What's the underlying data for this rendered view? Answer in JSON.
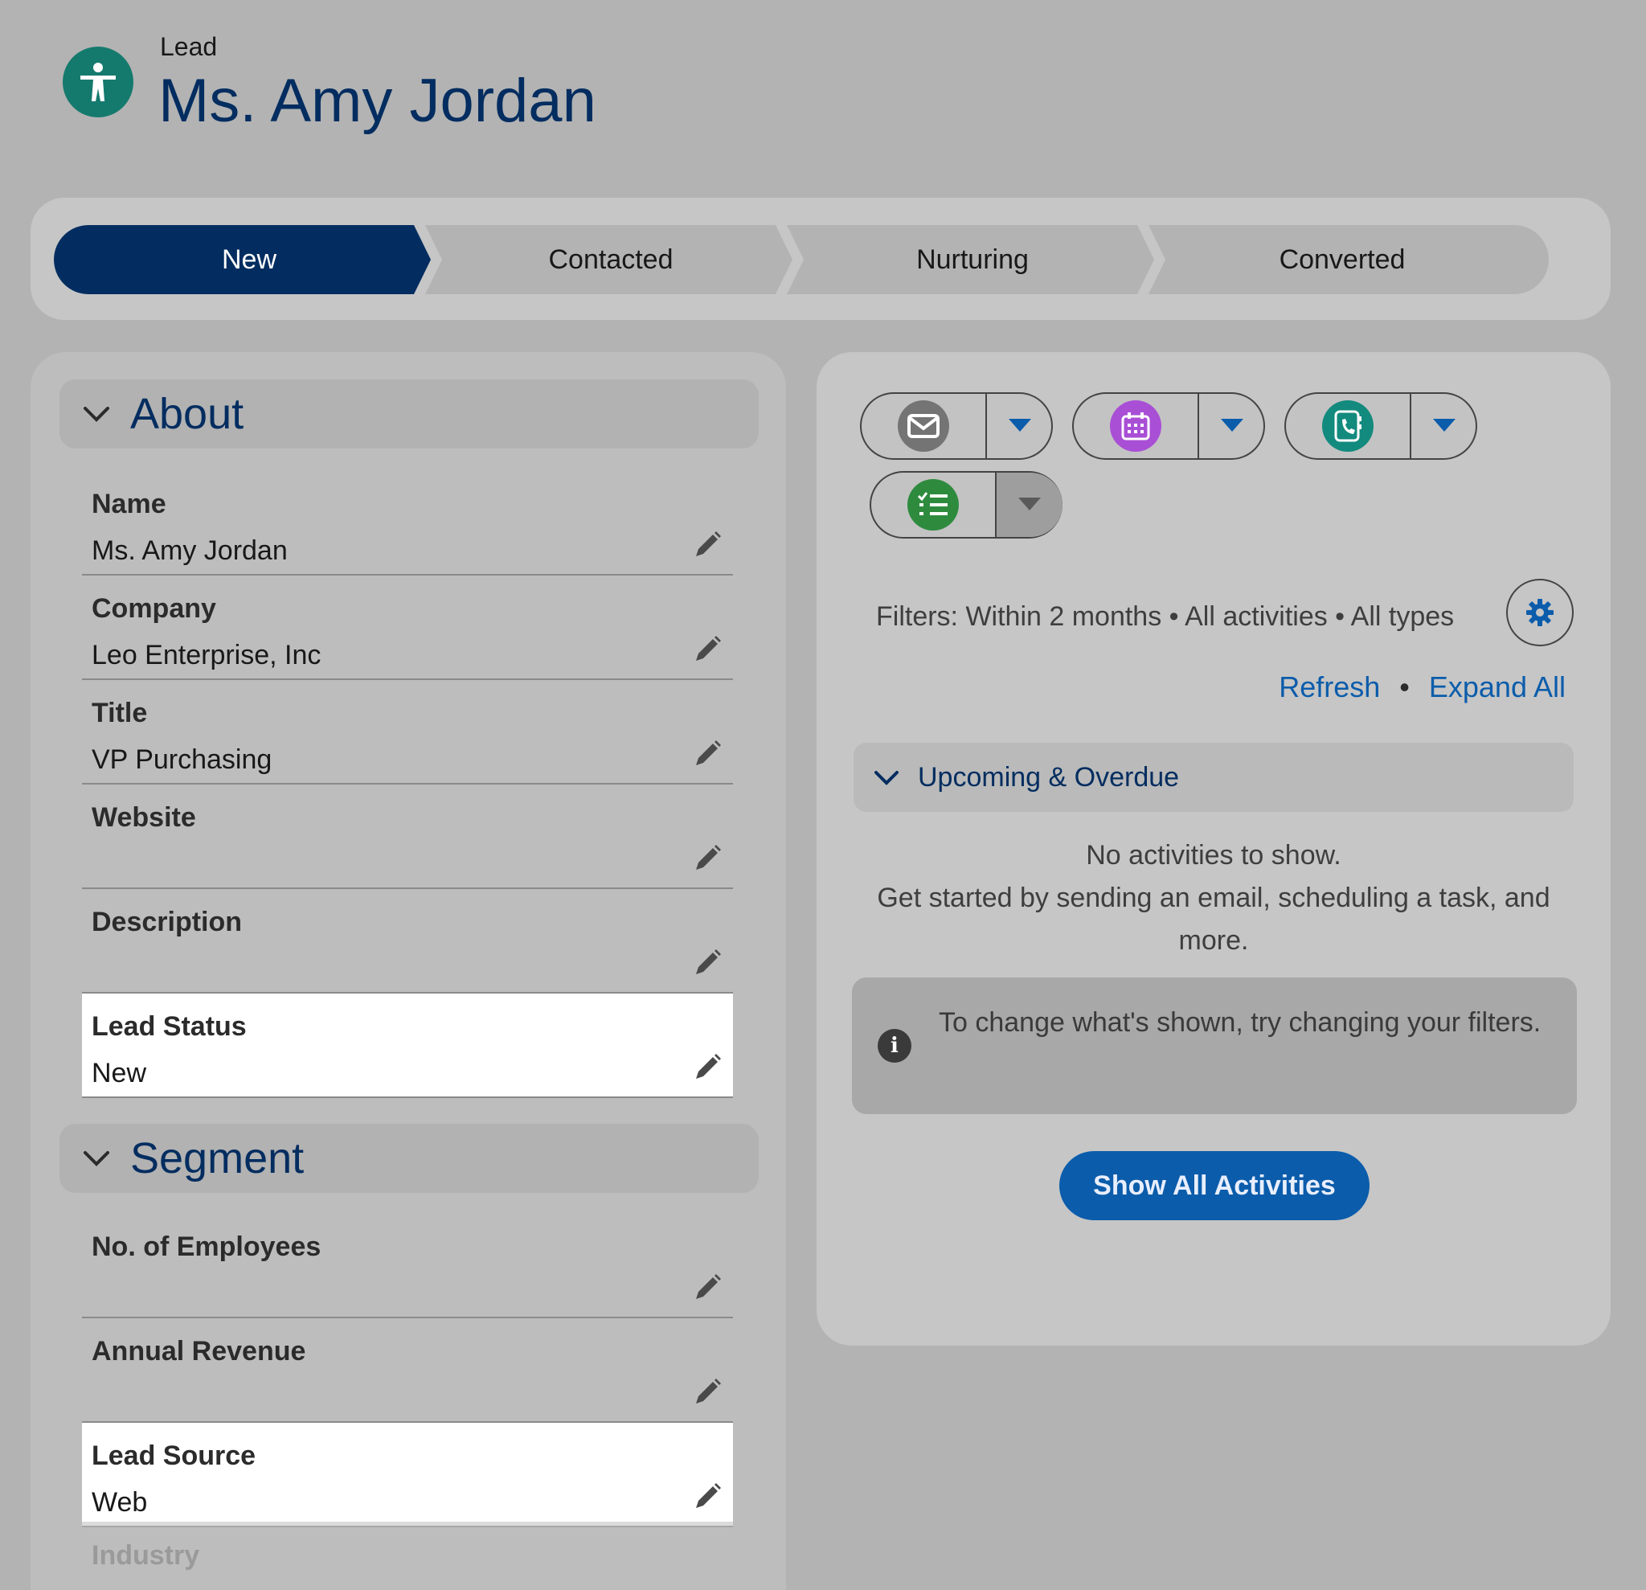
{
  "header": {
    "record_type": "Lead",
    "record_name": "Ms. Amy Jordan",
    "icon": "person-standing-icon",
    "icon_color": "#157a6e"
  },
  "path": {
    "stages": [
      {
        "label": "New",
        "active": true
      },
      {
        "label": "Contacted",
        "active": false
      },
      {
        "label": "Nurturing",
        "active": false
      },
      {
        "label": "Converted",
        "active": false
      }
    ],
    "active_color": "#032d60"
  },
  "about": {
    "title": "About",
    "fields": [
      {
        "label": "Name",
        "value": "Ms. Amy Jordan"
      },
      {
        "label": "Company",
        "value": "Leo Enterprise, Inc"
      },
      {
        "label": "Title",
        "value": "VP Purchasing"
      },
      {
        "label": "Website",
        "value": ""
      },
      {
        "label": "Description",
        "value": ""
      },
      {
        "label": "Lead Status",
        "value": "New"
      }
    ]
  },
  "segment": {
    "title": "Segment",
    "fields": [
      {
        "label": "No. of Employees",
        "value": ""
      },
      {
        "label": "Annual Revenue",
        "value": ""
      },
      {
        "label": "Lead Source",
        "value": "Web"
      },
      {
        "label": "Industry",
        "value": ""
      }
    ]
  },
  "activity": {
    "actions": [
      {
        "icon": "email-icon",
        "color": "#747474"
      },
      {
        "icon": "calendar-icon",
        "color": "#a94fd6"
      },
      {
        "icon": "phone-icon",
        "color": "#138a7e"
      },
      {
        "icon": "task-list-icon",
        "color": "#2e8b3e"
      }
    ],
    "filters_text": "Filters: Within 2 months • All activities • All types",
    "refresh_label": "Refresh",
    "expand_all_label": "Expand All",
    "upcoming_title": "Upcoming & Overdue",
    "empty_line1": "No activities to show.",
    "empty_line2": "Get started by sending an email, scheduling a task, and more.",
    "info_text": "To change what's shown, try changing your filters.",
    "show_all_label": "Show All Activities",
    "link_color": "#0b5cab"
  }
}
